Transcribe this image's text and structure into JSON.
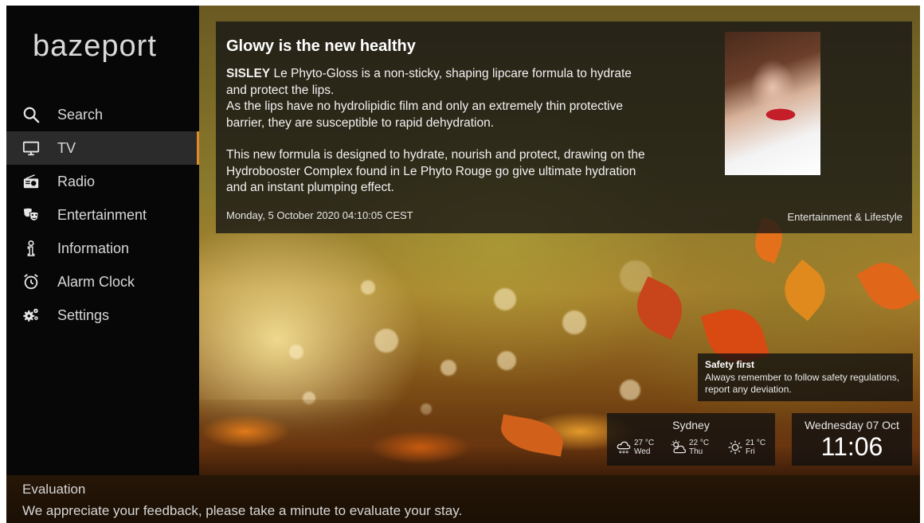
{
  "brand": {
    "logo_text": "bazeport"
  },
  "sidebar": {
    "items": [
      {
        "label": "Search",
        "icon": "search-icon"
      },
      {
        "label": "TV",
        "icon": "tv-icon",
        "active": true
      },
      {
        "label": "Radio",
        "icon": "radio-icon"
      },
      {
        "label": "Entertainment",
        "icon": "masks-icon"
      },
      {
        "label": "Information",
        "icon": "info-icon"
      },
      {
        "label": "Alarm Clock",
        "icon": "alarm-clock-icon"
      },
      {
        "label": "Settings",
        "icon": "gears-icon"
      }
    ],
    "accent_color": "#e08a2a"
  },
  "article": {
    "title": "Glowy is the new healthy",
    "brand_word": "SISLEY",
    "paragraph1": " Le Phyto-Gloss is a non-sticky, shaping lipcare formula to hydrate and protect the lips.",
    "paragraph2": "As the lips have no hydrolipidic film and only an extremely thin protective barrier, they are susceptible to rapid dehydration.",
    "paragraph3": "This new formula is designed to hydrate, nourish and protect, drawing on the Hydrobooster Complex found in Le Phyto Rouge go give ultimate hydration and an instant plumping effect.",
    "date": "Monday, 5 October 2020 04:10:05 CEST",
    "category": "Entertainment & Lifestyle"
  },
  "safety": {
    "title": "Safety first",
    "text": "Always remember to follow safety regulations, report any deviation."
  },
  "weather": {
    "city": "Sydney",
    "forecast": [
      {
        "temp": "27 °C",
        "day": "Wed",
        "icon": "rain-cloud-icon"
      },
      {
        "temp": "22 °C",
        "day": "Thu",
        "icon": "partly-cloudy-icon"
      },
      {
        "temp": "21 °C",
        "day": "Fri",
        "icon": "sun-icon"
      }
    ]
  },
  "clock": {
    "date": "Wednesday 07 Oct",
    "time": "11:06"
  },
  "evaluation": {
    "title": "Evaluation",
    "text": "We appreciate your feedback, please take a minute to evaluate your stay."
  }
}
